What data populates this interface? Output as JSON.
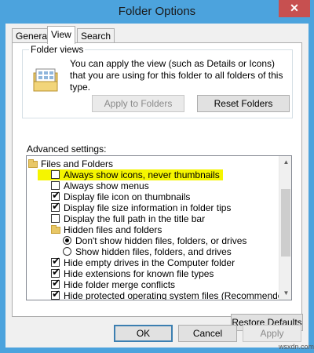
{
  "window": {
    "title": "Folder Options",
    "close_glyph": "✕"
  },
  "tabs": [
    {
      "label": "General"
    },
    {
      "label": "View"
    },
    {
      "label": "Search"
    }
  ],
  "folder_views": {
    "legend": "Folder views",
    "description": "You can apply the view (such as Details or Icons) that you are using for this folder to all folders of this type.",
    "apply_button": "Apply to Folders",
    "reset_button": "Reset Folders"
  },
  "advanced": {
    "label": "Advanced settings:",
    "items": [
      {
        "type": "folder",
        "label": "Files and Folders",
        "indent": 0
      },
      {
        "type": "checkbox",
        "label": "Always show icons, never thumbnails",
        "checked": false,
        "indent": 1,
        "highlighted": true
      },
      {
        "type": "checkbox",
        "label": "Always show menus",
        "checked": false,
        "indent": 1
      },
      {
        "type": "checkbox",
        "label": "Display file icon on thumbnails",
        "checked": true,
        "indent": 1
      },
      {
        "type": "checkbox",
        "label": "Display file size information in folder tips",
        "checked": true,
        "indent": 1
      },
      {
        "type": "checkbox",
        "label": "Display the full path in the title bar",
        "checked": false,
        "indent": 1
      },
      {
        "type": "folder",
        "label": "Hidden files and folders",
        "indent": 1
      },
      {
        "type": "radio",
        "label": "Don't show hidden files, folders, or drives",
        "checked": true,
        "indent": 2
      },
      {
        "type": "radio",
        "label": "Show hidden files, folders, and drives",
        "checked": false,
        "indent": 2
      },
      {
        "type": "checkbox",
        "label": "Hide empty drives in the Computer folder",
        "checked": true,
        "indent": 1
      },
      {
        "type": "checkbox",
        "label": "Hide extensions for known file types",
        "checked": true,
        "indent": 1
      },
      {
        "type": "checkbox",
        "label": "Hide folder merge conflicts",
        "checked": true,
        "indent": 1
      },
      {
        "type": "checkbox",
        "label": "Hide protected operating system files (Recommended)",
        "checked": true,
        "indent": 1
      }
    ]
  },
  "restore_defaults_button": "Restore Defaults",
  "footer": {
    "ok": "OK",
    "cancel": "Cancel",
    "apply": "Apply"
  },
  "watermark": "wsxdn.com",
  "colors": {
    "title_bar": "#4ca3dd",
    "close": "#c75050",
    "highlight": "#f5f500"
  }
}
